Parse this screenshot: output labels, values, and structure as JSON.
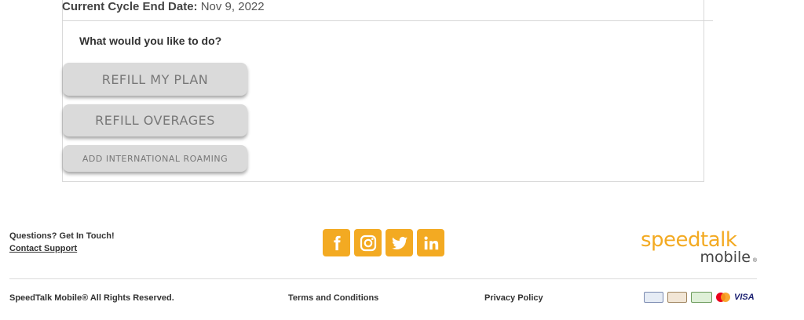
{
  "cycle": {
    "label": "Current Cycle End Date:",
    "value": "Nov 9, 2022"
  },
  "prompt": "What would you like to do?",
  "actions": {
    "refill_plan": "REFILL MY PLAN",
    "refill_overages": "REFILL OVERAGES",
    "add_roaming": "ADD INTERNATIONAL ROAMING"
  },
  "footer": {
    "contact_question": "Questions? Get In Touch!",
    "contact_link": "Contact Support",
    "social": [
      "facebook-icon",
      "instagram-icon",
      "twitter-icon",
      "linkedin-icon"
    ],
    "logo_line1": "speedtalk",
    "logo_line2": "mobile",
    "logo_reg": "®",
    "rights": "SpeedTalk Mobile® All Rights Reserved.",
    "terms": "Terms and Conditions",
    "privacy": "Privacy Policy",
    "visa_label": "VISA"
  },
  "colors": {
    "accent": "#f3aa22",
    "button_bg": "#dadada",
    "button_text": "#777777"
  }
}
